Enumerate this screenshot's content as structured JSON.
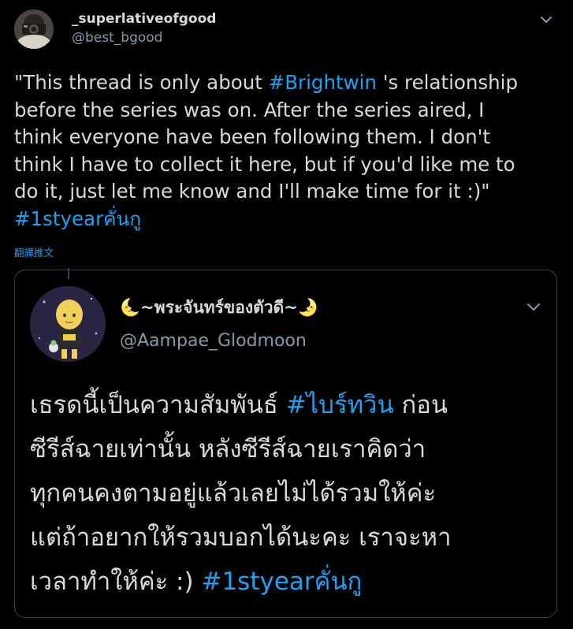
{
  "tweet": {
    "display_name": "_superlativeofgood",
    "handle": "@best_bgood",
    "text_lines": [
      [
        "\"This thread is only about ",
        "#Brightwin",
        " 's relationship"
      ],
      "before the series was on. After the series aired, I",
      "think everyone have been following them. I don't",
      "think I have to collect it here, but if you'd like me to",
      "do it, just let me know and I'll make time for it :)\""
    ],
    "hashtag_line": "#1styearคั่นกู",
    "translate_label": "翻譯推文",
    "menu_icon": "chevron-down-icon",
    "avatar_icon": "camera-avatar"
  },
  "quote": {
    "display_name": "🌜~พระจันทร์ของตัวดี~🌛",
    "handle": "@Aampae_Glodmoon",
    "text_lines": [
      [
        "เธรดนี้เป็นความสัมพันธ์ ",
        "#ไบร์ทวิน",
        " ก่อน"
      ],
      "ซีรีส์ฉายเท่านั้น หลังซีรีส์ฉายเราคิดว่า",
      "ทุกคนคงตามอยู่แล้วเลยไม่ได้รวมให้ค่ะ",
      "แต่ถ้าอยากให้รวมบอกได้นะคะ เราจะหา",
      [
        "เวลาทำให้ค่ะ :) ",
        "#1styearคั่นกู"
      ]
    ],
    "menu_icon": "chevron-down-icon",
    "avatar_icon": "cartoon-avatar"
  },
  "colors": {
    "background": "#000000",
    "text": "#d9d9d9",
    "muted": "#8899a6",
    "link": "#1da1f2",
    "border": "#38444d"
  }
}
